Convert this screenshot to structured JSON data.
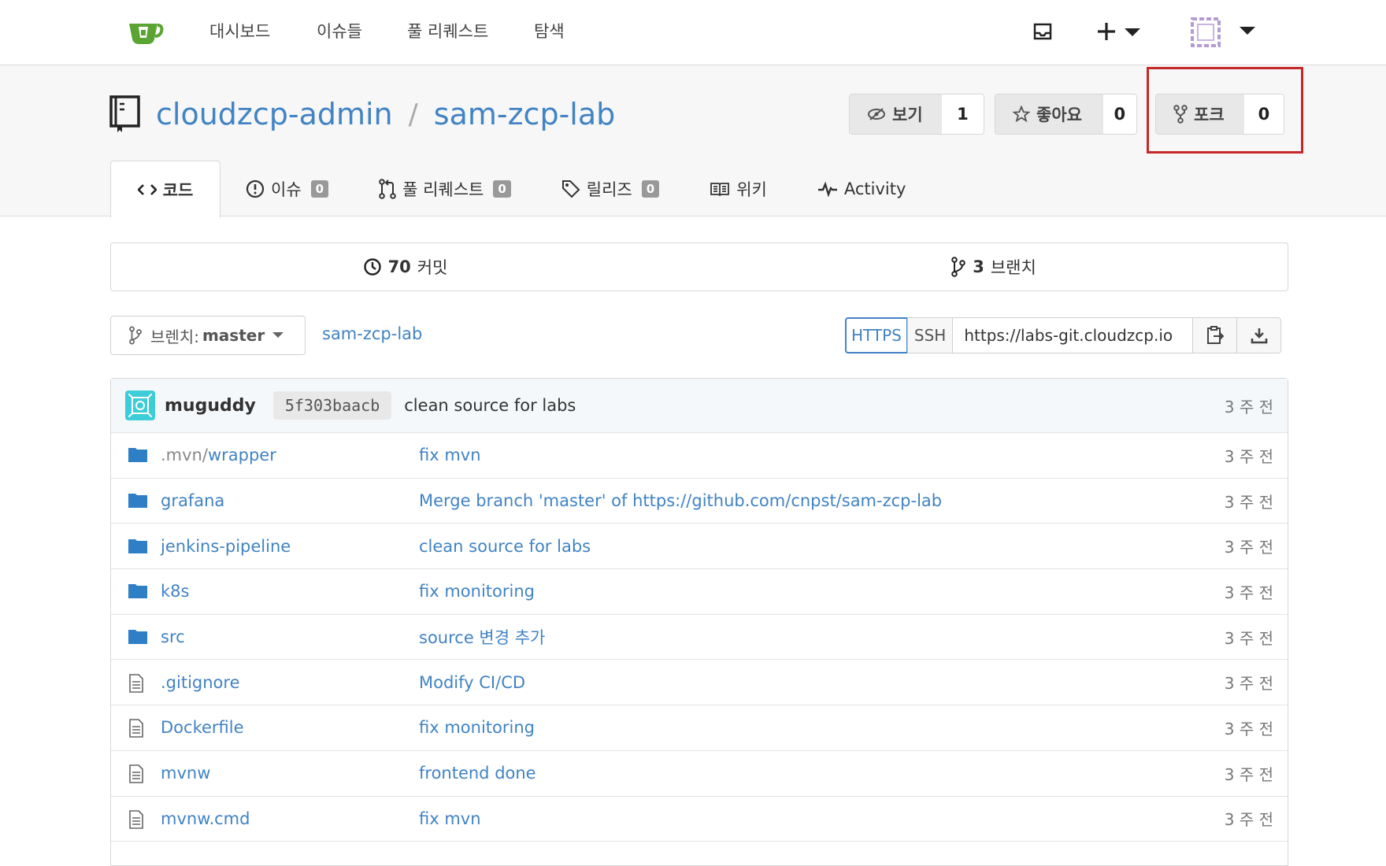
{
  "nav": {
    "items": [
      "대시보드",
      "이슈들",
      "풀 리퀘스트",
      "탐색"
    ],
    "logo_icon": "gitea-cup-icon",
    "inbox_icon": "inbox-icon",
    "plus_icon": "plus-icon",
    "avatar_icon": "avatar-icon"
  },
  "repo": {
    "owner": "cloudzcp-admin",
    "separator": "/",
    "name": "sam-zcp-lab",
    "watch": {
      "label": "보기",
      "count": "1"
    },
    "star": {
      "label": "좋아요",
      "count": "0"
    },
    "fork": {
      "label": "포크",
      "count": "0"
    }
  },
  "tabs": [
    {
      "label": "코드",
      "badge": null
    },
    {
      "label": "이슈",
      "badge": "0"
    },
    {
      "label": "풀 리퀘스트",
      "badge": "0"
    },
    {
      "label": "릴리즈",
      "badge": "0"
    },
    {
      "label": "위키",
      "badge": null
    },
    {
      "label": "Activity",
      "badge": null
    }
  ],
  "stats": {
    "commits_count": "70",
    "commits_label": "커밋",
    "branches_count": "3",
    "branches_label": "브랜치"
  },
  "branch": {
    "label": "브렌치:",
    "value": "master",
    "path": "sam-zcp-lab"
  },
  "clone": {
    "https": "HTTPS",
    "ssh": "SSH",
    "url": "https://labs-git.cloudzcp.io"
  },
  "latest_commit": {
    "author": "muguddy",
    "sha": "5f303baacb",
    "message": "clean source for labs",
    "time": "3 주 전"
  },
  "files": [
    {
      "type": "dir",
      "prefix": ".mvn/",
      "name": "wrapper",
      "message": "fix mvn",
      "time": "3 주 전"
    },
    {
      "type": "dir",
      "prefix": "",
      "name": "grafana",
      "message": "Merge branch 'master' of https://github.com/cnpst/sam-zcp-lab",
      "time": "3 주 전"
    },
    {
      "type": "dir",
      "prefix": "",
      "name": "jenkins-pipeline",
      "message": "clean source for labs",
      "time": "3 주 전"
    },
    {
      "type": "dir",
      "prefix": "",
      "name": "k8s",
      "message": "fix monitoring",
      "time": "3 주 전"
    },
    {
      "type": "dir",
      "prefix": "",
      "name": "src",
      "message": "source 변경 추가",
      "time": "3 주 전"
    },
    {
      "type": "file",
      "prefix": "",
      "name": ".gitignore",
      "message": "Modify CI/CD",
      "time": "3 주 전"
    },
    {
      "type": "file",
      "prefix": "",
      "name": "Dockerfile",
      "message": "fix monitoring",
      "time": "3 주 전"
    },
    {
      "type": "file",
      "prefix": "",
      "name": "mvnw",
      "message": "frontend done",
      "time": "3 주 전"
    },
    {
      "type": "file",
      "prefix": "",
      "name": "mvnw.cmd",
      "message": "fix mvn",
      "time": "3 주 전"
    }
  ],
  "colors": {
    "link": "#4183c4",
    "highlight": "#c62828",
    "logo": "#5aa532"
  }
}
